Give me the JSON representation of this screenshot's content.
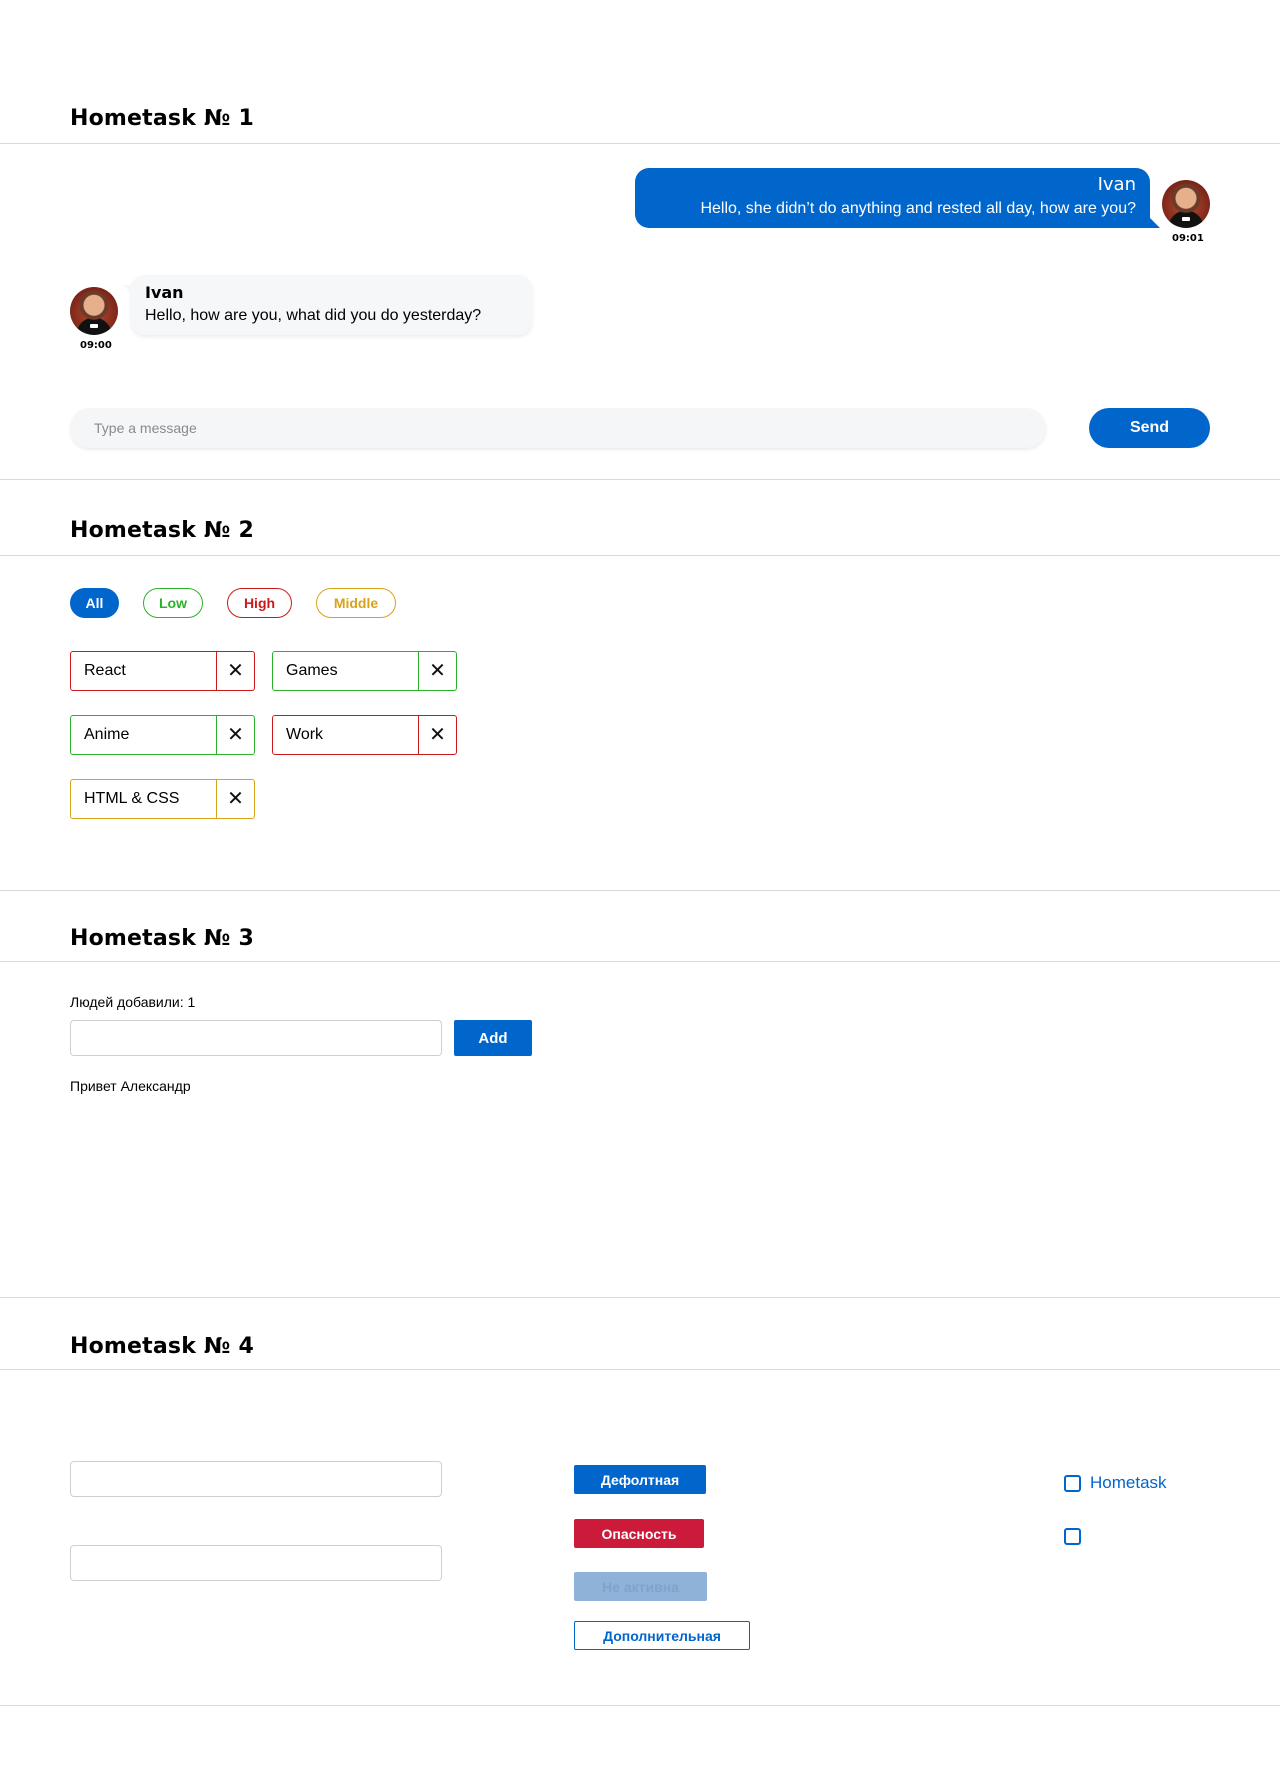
{
  "sections": [
    {
      "title": "Hometask № 1"
    },
    {
      "title": "Hometask № 2"
    },
    {
      "title": "Hometask № 3"
    },
    {
      "title": "Hometask № 4"
    }
  ],
  "chat": {
    "outgoing": {
      "name": "Ivan",
      "text": "Hello, she didn’t do anything and rested all day, how are you?",
      "time": "09:01"
    },
    "incoming": {
      "name": "Ivan",
      "text": "Hello, how are you, what did you do yesterday?",
      "time": "09:00"
    },
    "input_placeholder": "Type a message",
    "send_label": "Send"
  },
  "filters": {
    "items": [
      {
        "label": "All",
        "color": "#0066cc",
        "active": true
      },
      {
        "label": "Low",
        "color": "#2ab32a",
        "active": false
      },
      {
        "label": "High",
        "color": "#cc1a1a",
        "active": false
      },
      {
        "label": "Middle",
        "color": "#d9a21b",
        "active": false
      }
    ]
  },
  "tags": [
    {
      "label": "React",
      "priority": "high",
      "color": "#cc1a1a"
    },
    {
      "label": "Games",
      "priority": "low",
      "color": "#2ab32a"
    },
    {
      "label": "Anime",
      "priority": "low",
      "color": "#2ab32a"
    },
    {
      "label": "Work",
      "priority": "high",
      "color": "#cc1a1a"
    },
    {
      "label": "HTML & CSS",
      "priority": "middle",
      "color": "#d9a21b"
    }
  ],
  "tag_close_glyph": "✕",
  "greeting": {
    "count_text": "Людей добавили: 1",
    "add_label": "Add",
    "greeting_text": "Привет Александр"
  },
  "task4": {
    "buttons": {
      "default_label": "Дефолтная",
      "danger_label": "Опасность",
      "disabled_label": "Не активна",
      "secondary_label": "Дополнительная"
    },
    "checkbox_label": "Hometask"
  },
  "colors": {
    "primary": "#0066cc",
    "danger": "#cc1a3a",
    "disabled": "#8fb2d9"
  }
}
